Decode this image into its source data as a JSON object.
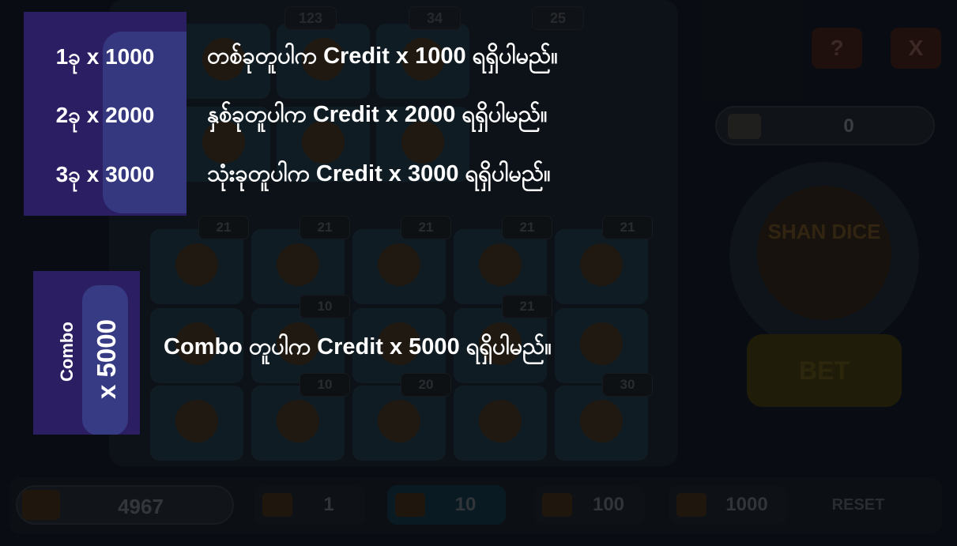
{
  "background": {
    "top_badges": [
      "123",
      "34",
      "25"
    ],
    "tile_badges": [
      "21",
      "21",
      "21",
      "21",
      "21",
      "10",
      "21",
      "10",
      "20",
      "30"
    ],
    "help_icon_label": "?",
    "close_icon_label": "X",
    "win_value": "0",
    "dice_logo": "SHAN DICE",
    "bet_label": "BET",
    "balance": "4967",
    "chips": [
      "1",
      "10",
      "100",
      "1000"
    ],
    "selected_chip": "10",
    "reset_label": "RESET"
  },
  "help": {
    "multipliers": [
      "1ခု x 1000",
      "2ခု x 2000",
      "3ခု x 3000"
    ],
    "rules": [
      "တစ်ခုတူပါက Credit x 1000 ရရှိပါမည်။",
      "နှစ်ခုတူပါက Credit x 2000 ရရှိပါမည်။",
      "သုံးခုတူပါက Credit x 3000 ရရှိပါမည်။"
    ],
    "combo_label": "Combo",
    "combo_multiplier": "x 5000",
    "combo_rule": "Combo တူပါက Credit x 5000 ရရှိပါမည်။"
  }
}
